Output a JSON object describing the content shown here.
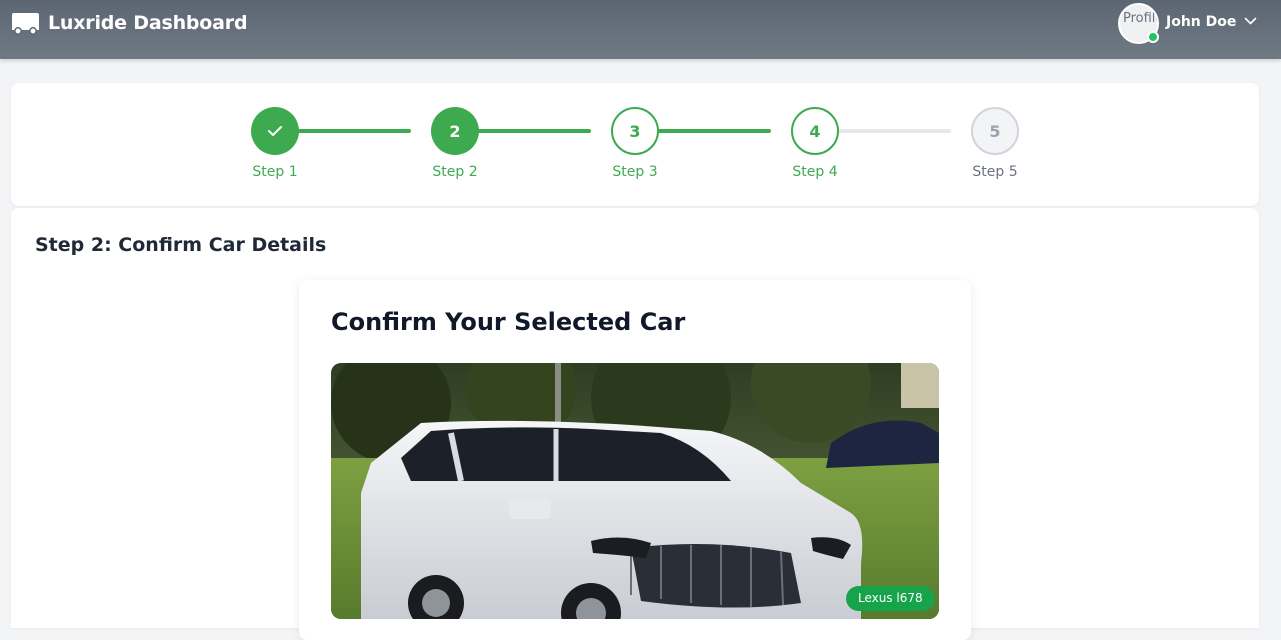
{
  "navbar": {
    "brand_icon": "truck-icon",
    "title": "Luxride Dashboard",
    "user": {
      "avatar_alt": "Profile",
      "name": "John Doe",
      "status": "online",
      "menu_icon": "chevron-down-icon"
    }
  },
  "colors": {
    "accent": "#3daa50",
    "badge": "#16a34a",
    "navbar": "#5b6672",
    "online": "#22c55e"
  },
  "stepper": {
    "steps": [
      {
        "number": "✓",
        "label": "Step 1",
        "state": "complete"
      },
      {
        "number": "2",
        "label": "Step 2",
        "state": "active"
      },
      {
        "number": "3",
        "label": "Step 3",
        "state": "pending"
      },
      {
        "number": "4",
        "label": "Step 4",
        "state": "pending"
      },
      {
        "number": "5",
        "label": "Step 5",
        "state": "upcoming"
      }
    ]
  },
  "main": {
    "section_title": "Step 2: Confirm Car Details",
    "card": {
      "title": "Confirm Your Selected Car",
      "image": "white-suv-photo",
      "badge": "Lexus l678"
    }
  }
}
